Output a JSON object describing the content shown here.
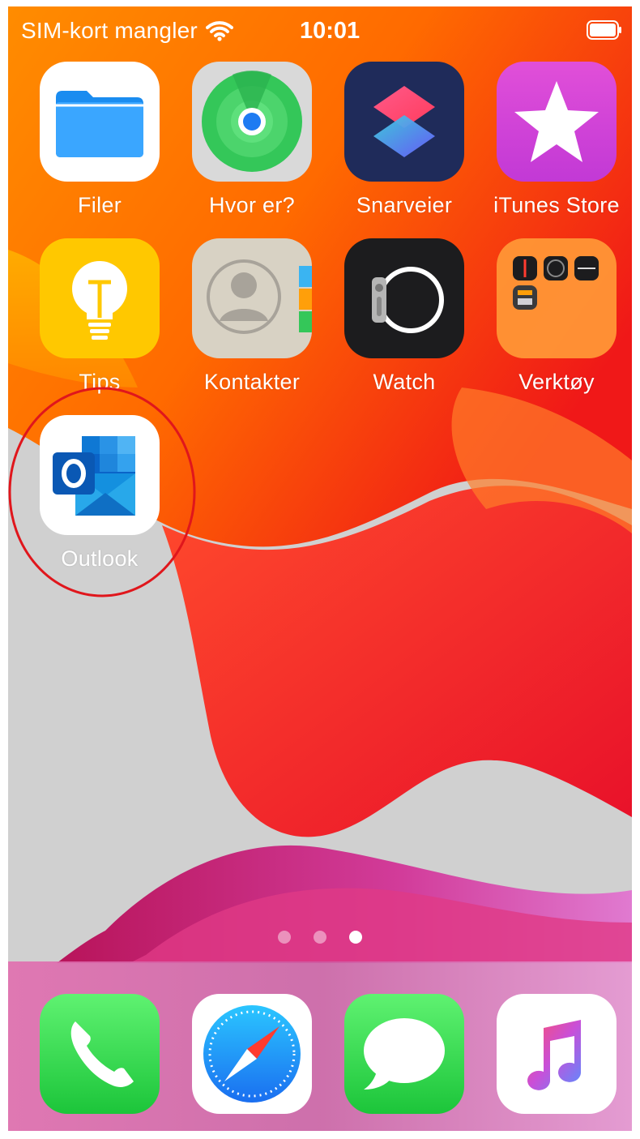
{
  "status_bar": {
    "carrier": "SIM-kort mangler",
    "time": "10:01"
  },
  "home_screen": {
    "apps": [
      {
        "name": "Filer",
        "icon": "files-folder-icon"
      },
      {
        "name": "Hvor er?",
        "icon": "find-my-radar-icon"
      },
      {
        "name": "Snarveier",
        "icon": "shortcuts-icon"
      },
      {
        "name": "iTunes Store",
        "icon": "star-icon"
      },
      {
        "name": "Tips",
        "icon": "lightbulb-icon"
      },
      {
        "name": "Kontakter",
        "icon": "contacts-person-icon"
      },
      {
        "name": "Watch",
        "icon": "apple-watch-icon"
      },
      {
        "name": "Verktøy",
        "icon": "folder-utilities-icon"
      },
      {
        "name": "Outlook",
        "icon": "outlook-icon"
      }
    ],
    "page_indicator": {
      "pages": 3,
      "current_page": 3
    }
  },
  "dock": {
    "apps": [
      {
        "icon": "phone-icon"
      },
      {
        "icon": "safari-compass-icon"
      },
      {
        "icon": "messages-bubble-icon"
      },
      {
        "icon": "music-note-icon"
      }
    ]
  },
  "annotation": {
    "type": "red circle",
    "highlights": "Outlook",
    "color": "#e0161c"
  },
  "colors": {
    "wallpaper_orange": "#ff7a00",
    "wallpaper_red": "#f0202a",
    "outlook_blue": "#0a64c8"
  }
}
